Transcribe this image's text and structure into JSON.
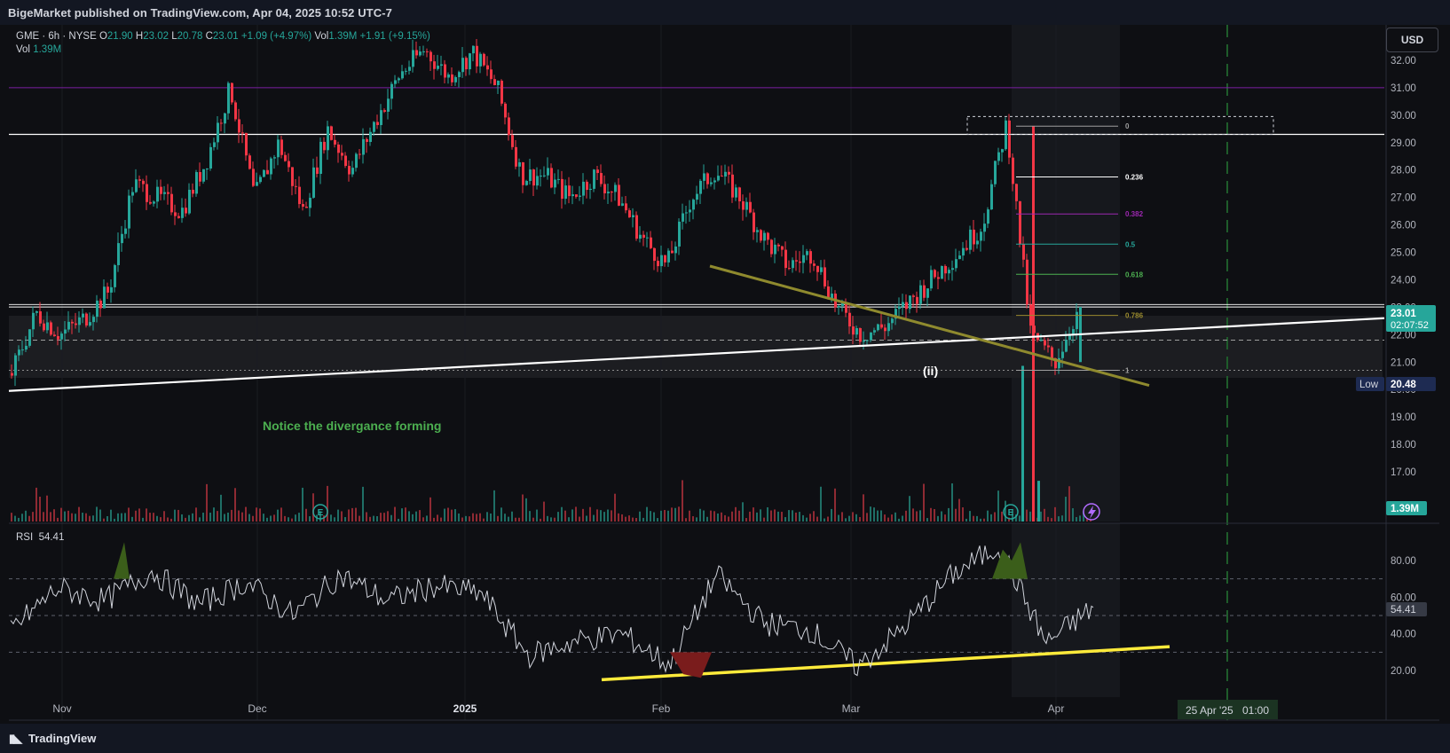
{
  "publisher": "BigeMarket published on TradingView.com, Apr 04, 2025 10:52 UTC-7",
  "legend": {
    "symbol": "GME · 6h · NYSE",
    "open_label": "O",
    "open": "21.90",
    "high_label": "H",
    "high": "23.02",
    "low_label": "L",
    "low": "20.78",
    "close_label": "C",
    "close": "23.01",
    "change": "+1.09 (+4.97%)",
    "vol_label": "Vol",
    "vol": "1.39M",
    "vol_ma_change": "+1.91 (+9.15%)",
    "vol_row_label": "Vol",
    "vol_row_value": "1.39M"
  },
  "currency_button": "USD",
  "price_badge": {
    "price": "23.01",
    "countdown": "02:07:52"
  },
  "low_badge": {
    "label": "Low",
    "value": "20.48"
  },
  "volume_badge": "1.39M",
  "rsi": {
    "label": "RSI",
    "value": "54.41",
    "badge": "54.41"
  },
  "annotations": {
    "divergence_note": "Notice the divergance forming",
    "wave_label": "(ii)"
  },
  "fib_levels": [
    {
      "label": "0",
      "price": 29.6,
      "color": "#9e9e9e"
    },
    {
      "label": "0.236",
      "price": 27.75,
      "color": "#ffffff"
    },
    {
      "label": "0.382",
      "price": 26.4,
      "color": "#9c27b0"
    },
    {
      "label": "0.5",
      "price": 25.3,
      "color": "#26a69a"
    },
    {
      "label": "0.618",
      "price": 24.2,
      "color": "#4caf50"
    },
    {
      "label": "0.786",
      "price": 22.7,
      "color": "#9b8b2e"
    },
    {
      "label": "1",
      "price": 20.7,
      "color": "#9e9e9e"
    }
  ],
  "time_badge": {
    "date": "25 Apr '25",
    "time": "01:00"
  },
  "footer_brand": "TradingView",
  "colors": {
    "up": "#26a69a",
    "down": "#f23645",
    "rsi_line": "#d1d4dc",
    "trend_yellow": "#ffeb3b",
    "trend_olive": "#8f8a2e"
  },
  "chart_data": [
    {
      "type": "line",
      "subtype": "candlestick",
      "title": "GME · 6h · NYSE",
      "ylim": [
        15.5,
        33.0
      ],
      "y_ticks": [
        "32.00",
        "31.00",
        "30.00",
        "29.00",
        "28.00",
        "27.00",
        "26.00",
        "25.00",
        "24.00",
        "23.00",
        "22.00",
        "21.00",
        "20.00",
        "19.00",
        "18.00",
        "17.00"
      ],
      "x_ticks": [
        "Nov",
        "Dec",
        "2025",
        "Feb",
        "Mar",
        "Apr"
      ],
      "series": [
        {
          "name": "GME",
          "x": [
            "Oct 28",
            "Nov 1",
            "Nov 5",
            "Nov 8",
            "Nov 12",
            "Nov 15",
            "Nov 19",
            "Nov 22",
            "Nov 26",
            "Dec 2",
            "Dec 5",
            "Dec 9",
            "Dec 12",
            "Dec 16",
            "Dec 19",
            "Dec 23",
            "Dec 27",
            "Jan 2",
            "Jan 6",
            "Jan 9",
            "Jan 13",
            "Jan 16",
            "Jan 21",
            "Jan 24",
            "Jan 28",
            "Jan 31",
            "Feb 4",
            "Feb 7",
            "Feb 11",
            "Feb 13",
            "Feb 18",
            "Feb 21",
            "Feb 25",
            "Feb 28",
            "Mar 4",
            "Mar 7",
            "Mar 11",
            "Mar 14",
            "Mar 18",
            "Mar 21",
            "Mar 24",
            "Mar 26",
            "Mar 28",
            "Apr 1",
            "Apr 4"
          ],
          "values": [
            20.6,
            22.8,
            22.0,
            22.6,
            23.6,
            27.5,
            27.0,
            26.5,
            28.3,
            31.0,
            27.0,
            29.0,
            26.5,
            29.5,
            28.0,
            29.8,
            31.5,
            32.4,
            31.4,
            32.3,
            31.0,
            27.8,
            27.8,
            27.0,
            27.8,
            27.0,
            25.5,
            24.5,
            27.0,
            28.0,
            27.0,
            25.5,
            24.5,
            25.0,
            23.0,
            22.0,
            22.3,
            23.2,
            24.1,
            25.0,
            26.0,
            29.7,
            22.0,
            21.0,
            23.01
          ]
        }
      ]
    },
    {
      "type": "bar",
      "title": "Vol",
      "categories": [
        "Mar 25",
        "Mar 26",
        "Mar 27"
      ],
      "series": [
        {
          "name": "Vol",
          "values": [
            6.5,
            16.5,
            1.7
          ]
        }
      ]
    },
    {
      "type": "line",
      "title": "RSI",
      "ylim": [
        0,
        100
      ],
      "y_ticks": [
        "80.00",
        "60.00",
        "40.00",
        "20.00"
      ],
      "series": [
        {
          "name": "RSI",
          "x": [
            "Oct 28",
            "Nov 5",
            "Nov 12",
            "Nov 19",
            "Nov 26",
            "Dec 3",
            "Dec 10",
            "Dec 17",
            "Dec 24",
            "Jan 2",
            "Jan 10",
            "Jan 17",
            "Jan 24",
            "Jan 31",
            "Feb 7",
            "Feb 14",
            "Feb 21",
            "Feb 28",
            "Mar 7",
            "Mar 14",
            "Mar 21",
            "Mar 26",
            "Mar 31",
            "Apr 4"
          ],
          "values": [
            42,
            65,
            58,
            74,
            56,
            68,
            50,
            72,
            58,
            66,
            62,
            28,
            36,
            40,
            23,
            72,
            46,
            42,
            22,
            44,
            72,
            88,
            35,
            54.41
          ]
        }
      ]
    }
  ]
}
